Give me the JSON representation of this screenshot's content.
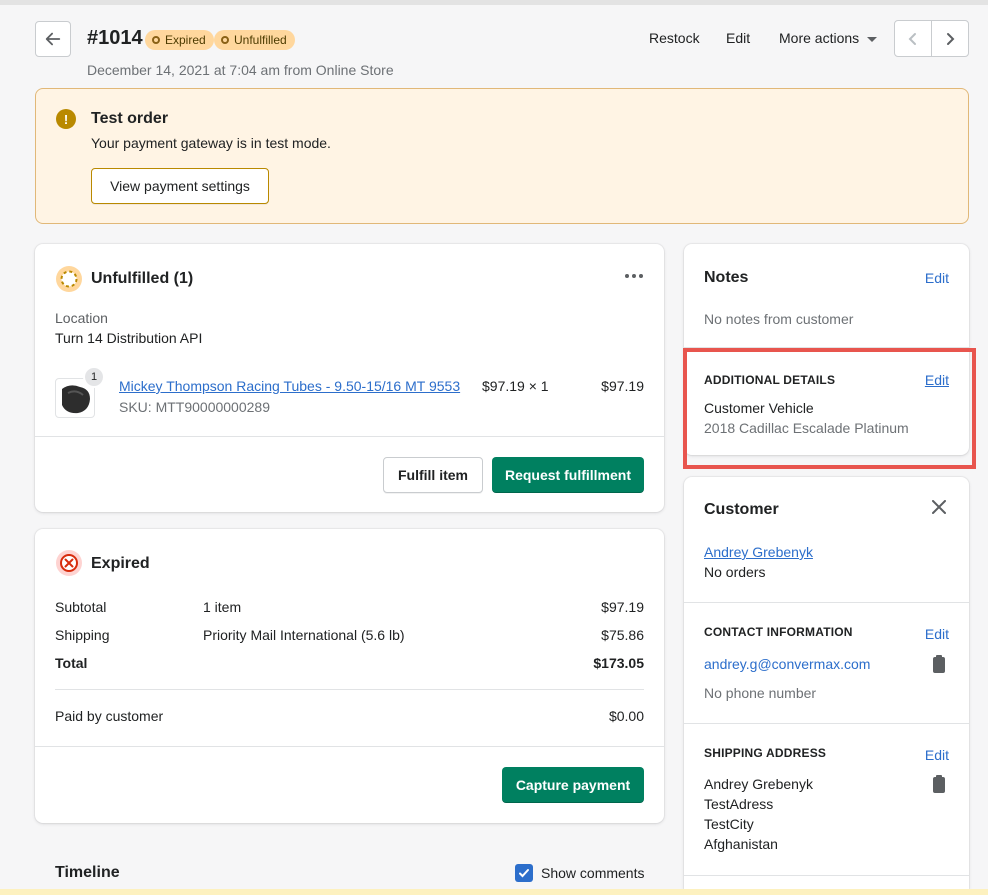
{
  "header": {
    "order_number": "#1014",
    "badges": [
      "Expired",
      "Unfulfilled"
    ],
    "subtitle": "December 14, 2021 at 7:04 am from Online Store",
    "actions": {
      "restock": "Restock",
      "edit": "Edit",
      "more": "More actions"
    }
  },
  "banner": {
    "title": "Test order",
    "text": "Your payment gateway is in test mode.",
    "button": "View payment settings"
  },
  "fulfillment": {
    "title": "Unfulfilled (1)",
    "location_label": "Location",
    "location_value": "Turn 14 Distribution API",
    "item": {
      "qty_badge": "1",
      "name": "Mickey Thompson Racing Tubes - 9.50-15/16 MT 9553",
      "sku": "SKU: MTT90000000289",
      "price_qty": "$97.19 × 1",
      "total": "$97.19"
    },
    "fulfill_button": "Fulfill item",
    "request_button": "Request fulfillment"
  },
  "payment": {
    "title": "Expired",
    "rows": [
      {
        "label": "Subtotal",
        "detail": "1 item",
        "amount": "$97.19"
      },
      {
        "label": "Shipping",
        "detail": "Priority Mail International (5.6 lb)",
        "amount": "$75.86"
      },
      {
        "label": "Total",
        "detail": "",
        "amount": "$173.05"
      }
    ],
    "paid_label": "Paid by customer",
    "paid_amount": "$0.00",
    "capture_button": "Capture payment"
  },
  "timeline": {
    "title": "Timeline",
    "show_comments": "Show comments"
  },
  "notes": {
    "title": "Notes",
    "edit": "Edit",
    "text": "No notes from customer"
  },
  "additional": {
    "heading": "ADDITIONAL DETAILS",
    "edit": "Edit",
    "label": "Customer Vehicle",
    "value": "2018 Cadillac Escalade Platinum"
  },
  "customer": {
    "title": "Customer",
    "name": "Andrey Grebenyk",
    "orders": "No orders",
    "contact_heading": "CONTACT INFORMATION",
    "contact_edit": "Edit",
    "email": "andrey.g@convermax.com",
    "phone": "No phone number",
    "shipping_heading": "SHIPPING ADDRESS",
    "shipping_edit": "Edit",
    "address": [
      "Andrey Grebenyk",
      "TestAdress",
      "TestCity",
      "Afghanistan"
    ]
  },
  "colors": {
    "primary_green": "#008060",
    "link_blue": "#2c6ecb",
    "badge_yellow": "#ffd79d",
    "banner_bg": "#fff4e4",
    "highlight_red": "#e8554e"
  }
}
